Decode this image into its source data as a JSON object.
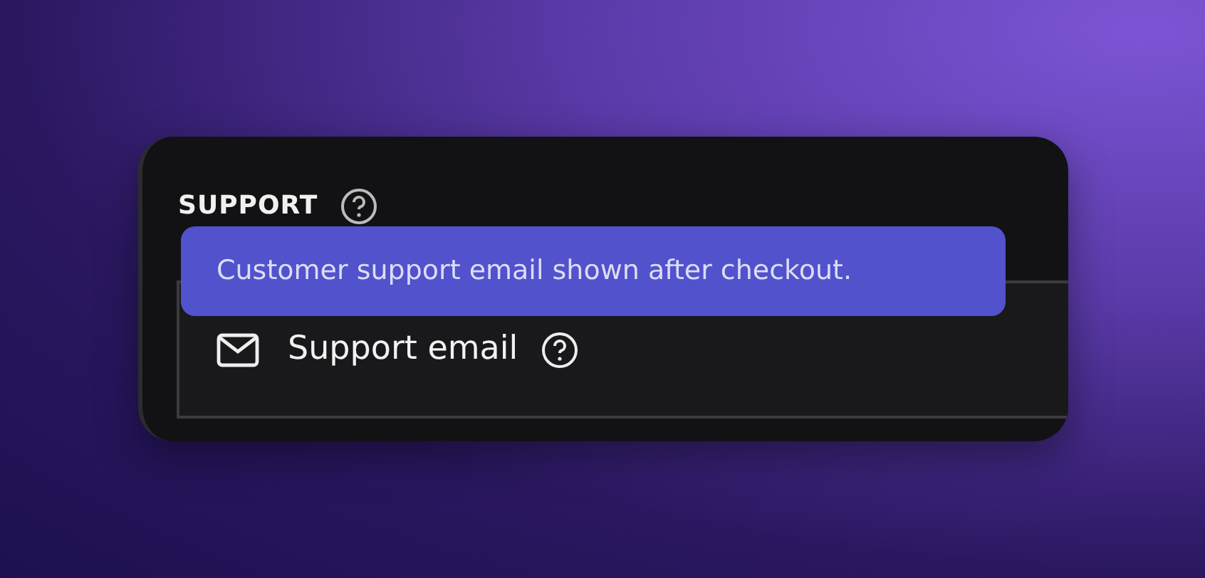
{
  "section": {
    "heading": "SUPPORT"
  },
  "field": {
    "label": "Support email"
  },
  "tooltip": {
    "text": "Customer support email shown after checkout."
  }
}
